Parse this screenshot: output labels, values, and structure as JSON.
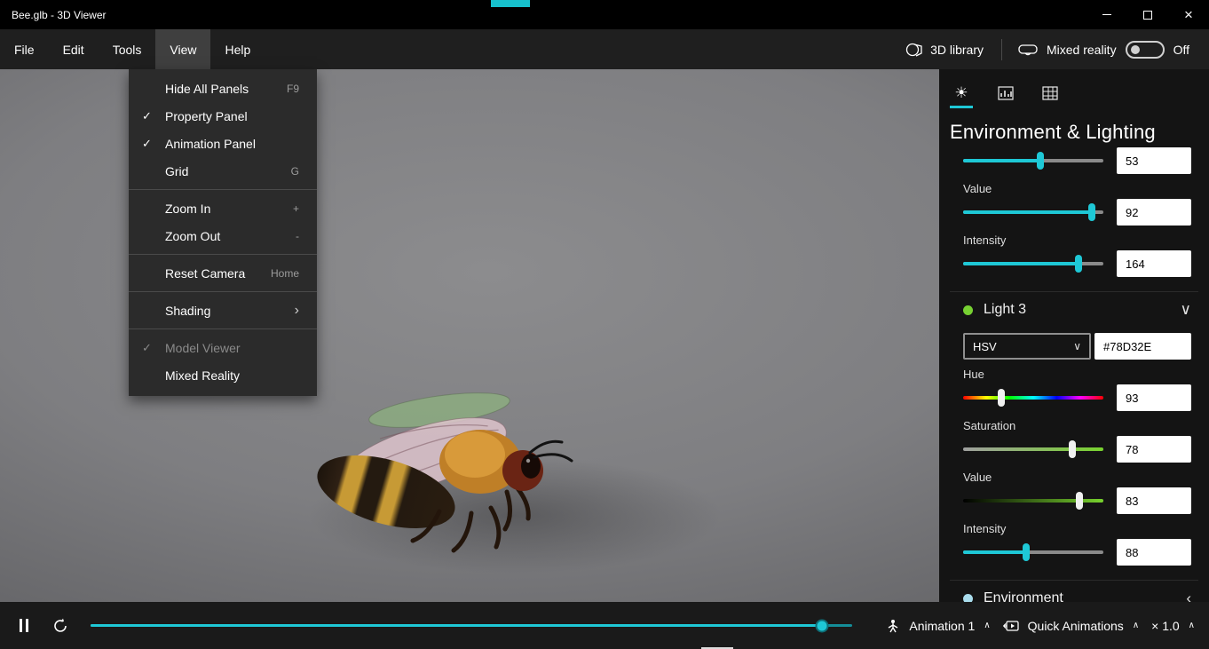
{
  "window": {
    "title": "Bee.glb - 3D Viewer"
  },
  "menubar": {
    "items": [
      "File",
      "Edit",
      "Tools",
      "View",
      "Help"
    ],
    "library_label": "3D library",
    "mixed_reality_label": "Mixed reality",
    "mixed_reality_state": "Off"
  },
  "view_menu": {
    "items": [
      {
        "label": "Hide All Panels",
        "shortcut": "F9"
      },
      {
        "label": "Property Panel",
        "checked": true
      },
      {
        "label": "Animation Panel",
        "checked": true
      },
      {
        "label": "Grid",
        "shortcut": "G"
      },
      {
        "label": "Zoom In",
        "shortcut": "+"
      },
      {
        "label": "Zoom Out",
        "shortcut": "-"
      },
      {
        "label": "Reset Camera",
        "shortcut": "Home"
      },
      {
        "label": "Shading",
        "submenu": true
      },
      {
        "label": "Model Viewer",
        "checked": true,
        "disabled": true
      },
      {
        "label": "Mixed Reality"
      }
    ]
  },
  "panel": {
    "title": "Environment & Lighting",
    "light2": {
      "top_value": "53",
      "rows": [
        {
          "label": "Value",
          "value": "92"
        },
        {
          "label": "Intensity",
          "value": "164"
        }
      ]
    },
    "light3": {
      "name": "Light 3",
      "color_mode": "HSV",
      "hex": "#78D32E",
      "dot_color": "#77d132",
      "rows": [
        {
          "label": "Hue",
          "value": "93"
        },
        {
          "label": "Saturation",
          "value": "78"
        },
        {
          "label": "Value",
          "value": "83"
        },
        {
          "label": "Intensity",
          "value": "88"
        }
      ]
    },
    "environment": {
      "name": "Environment",
      "dot_color": "#a9dcec"
    }
  },
  "bottombar": {
    "animation_label": "Animation 1",
    "quick_label": "Quick Animations",
    "speed_label": "× 1.0"
  },
  "icons": {
    "check": "✓",
    "chevron_right": "›",
    "chevron_down": "∨",
    "chevron_left": "‹",
    "chevron_up": "∧",
    "close": "×",
    "sun": "☀"
  },
  "colors": {
    "accent": "#1ec8d6",
    "light3_hex": "#78D32E"
  }
}
